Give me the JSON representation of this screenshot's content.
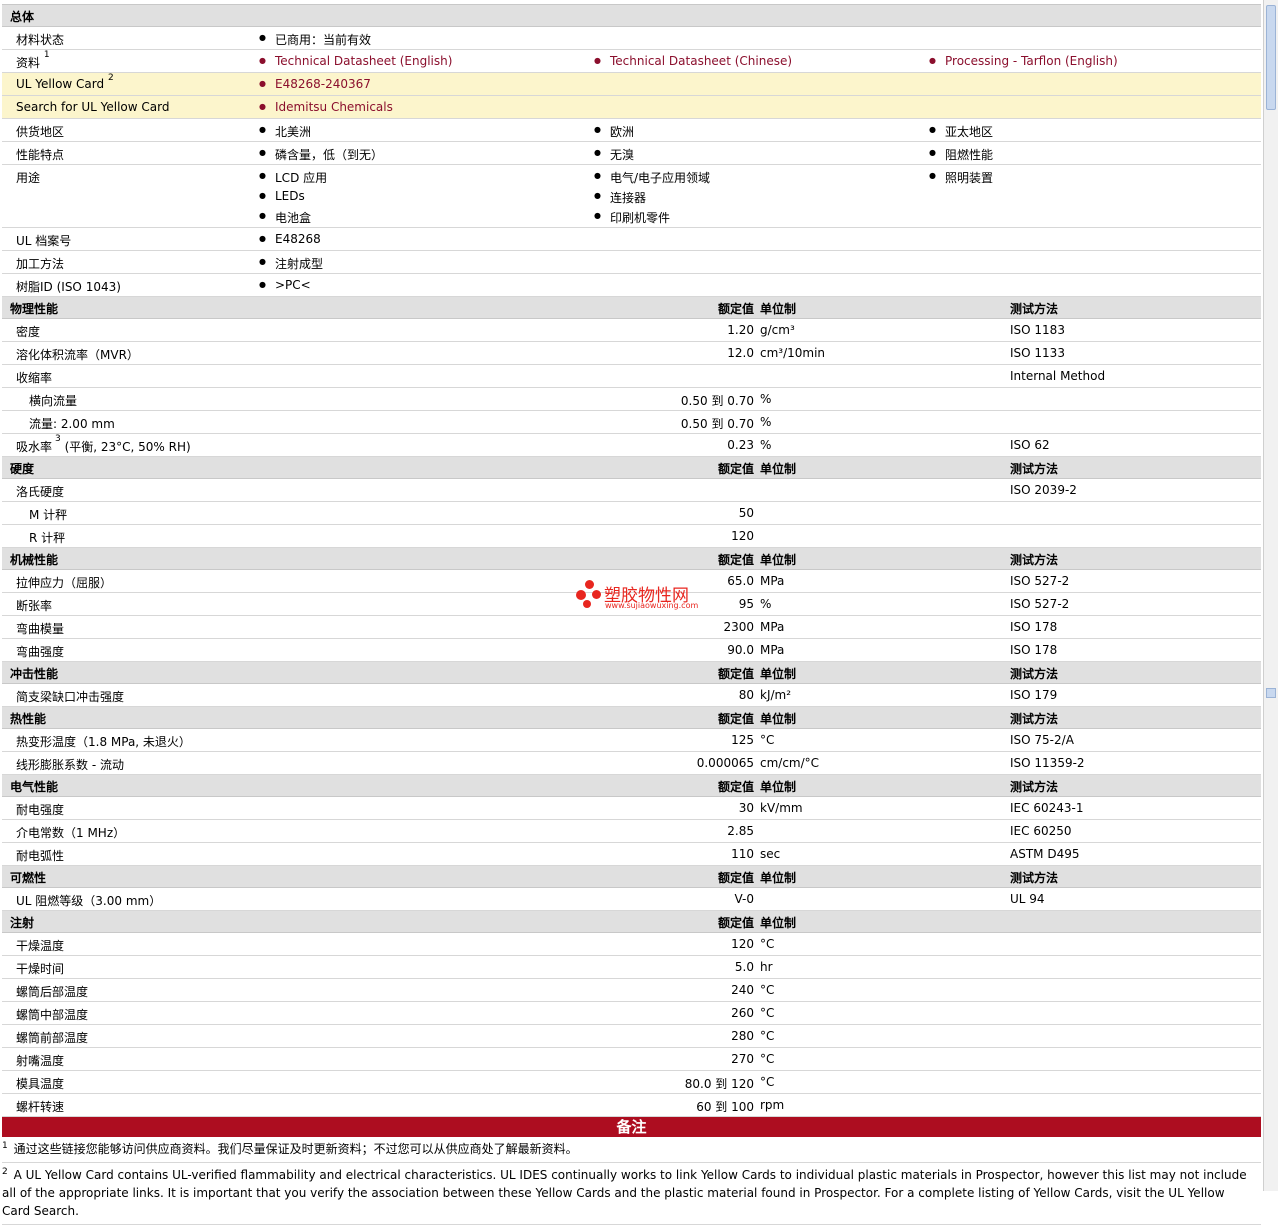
{
  "general": {
    "title": "总体",
    "material_status": {
      "label": "材料状态",
      "value": "已商用：当前有效"
    },
    "documents": {
      "label": "资料",
      "note": "1",
      "links": [
        "Technical Datasheet (English)",
        "Technical Datasheet (Chinese)",
        "Processing - Tarflon (English)"
      ]
    },
    "ul_yellow_card": {
      "label": "UL Yellow Card",
      "note": "2",
      "value": "E48268-240367"
    },
    "ul_search": {
      "label": "Search for UL Yellow Card",
      "value": "Idemitsu Chemicals"
    },
    "availability": {
      "label": "供货地区",
      "values": [
        "北美洲",
        "欧洲",
        "亚太地区"
      ]
    },
    "features": {
      "label": "性能特点",
      "values": [
        "磷含量，低（到无）",
        "无溴",
        "阻燃性能"
      ]
    },
    "uses": {
      "label": "用途",
      "values": [
        "LCD 应用",
        "电气/电子应用领域",
        "照明装置",
        "LEDs",
        "连接器",
        "电池盒",
        "印刷机零件"
      ]
    },
    "ul_file": {
      "label": "UL 档案号",
      "value": "E48268"
    },
    "processing": {
      "label": "加工方法",
      "value": "注射成型"
    },
    "resin_id": {
      "label": "树脂ID (ISO 1043)",
      "value": ">PC<"
    }
  },
  "headers": {
    "nominal": "额定值",
    "unit": "单位制",
    "method": "测试方法"
  },
  "sections": [
    {
      "title": "物理性能",
      "show_method": true,
      "rows": [
        {
          "label": "密度",
          "value": "1.20",
          "unit": "g/cm³",
          "method": "ISO 1183"
        },
        {
          "label": "溶化体积流率（MVR）",
          "value": "12.0",
          "unit": "cm³/10min",
          "method": "ISO 1133"
        },
        {
          "label": "收缩率",
          "value": "",
          "unit": "",
          "method": "Internal Method"
        },
        {
          "label": "横向流量",
          "sub": true,
          "value": "0.50 到  0.70",
          "unit": "%",
          "method": ""
        },
        {
          "label": "流量: 2.00 mm",
          "sub": true,
          "value": "0.50 到  0.70",
          "unit": "%",
          "method": ""
        },
        {
          "label": "吸水率",
          "note": "3",
          "label2": " (平衡, 23°C, 50% RH)",
          "value": "0.23",
          "unit": "%",
          "method": "ISO 62"
        }
      ]
    },
    {
      "title": "硬度",
      "show_method": true,
      "rows": [
        {
          "label": "洛氏硬度",
          "value": "",
          "unit": "",
          "method": "ISO 2039-2"
        },
        {
          "label": "M 计秤",
          "sub": true,
          "value": "50",
          "unit": "",
          "method": ""
        },
        {
          "label": "R 计秤",
          "sub": true,
          "value": "120",
          "unit": "",
          "method": ""
        }
      ]
    },
    {
      "title": "机械性能",
      "show_method": true,
      "rows": [
        {
          "label": "拉伸应力（屈服）",
          "value": "65.0",
          "unit": "MPa",
          "method": "ISO 527-2"
        },
        {
          "label": "断张率",
          "value": "95",
          "unit": "%",
          "method": "ISO 527-2"
        },
        {
          "label": "弯曲模量",
          "value": "2300",
          "unit": "MPa",
          "method": "ISO 178"
        },
        {
          "label": "弯曲强度",
          "value": "90.0",
          "unit": "MPa",
          "method": "ISO 178"
        }
      ]
    },
    {
      "title": "冲击性能",
      "show_method": true,
      "rows": [
        {
          "label": "简支梁缺口冲击强度",
          "value": "80",
          "unit": "kJ/m²",
          "method": "ISO 179"
        }
      ]
    },
    {
      "title": "热性能",
      "show_method": true,
      "rows": [
        {
          "label": "热变形温度（1.8 MPa, 未退火）",
          "value": "125",
          "unit": "°C",
          "method": "ISO 75-2/A"
        },
        {
          "label": "线形膨胀系数 - 流动",
          "value": "0.000065",
          "unit": "cm/cm/°C",
          "method": "ISO 11359-2"
        }
      ]
    },
    {
      "title": "电气性能",
      "show_method": true,
      "rows": [
        {
          "label": "耐电强度",
          "value": "30",
          "unit": "kV/mm",
          "method": "IEC 60243-1"
        },
        {
          "label": "介电常数（1 MHz）",
          "value": "2.85",
          "unit": "",
          "method": "IEC 60250"
        },
        {
          "label": "耐电弧性",
          "value": "110",
          "unit": "sec",
          "method": "ASTM D495"
        }
      ]
    },
    {
      "title": "可燃性",
      "show_method": true,
      "rows": [
        {
          "label": "UL 阻燃等级（3.00 mm）",
          "value": "V-0",
          "unit": "",
          "method": "UL 94"
        }
      ]
    },
    {
      "title": "注射",
      "show_method": false,
      "rows": [
        {
          "label": "干燥温度",
          "value": "120",
          "unit": "°C",
          "method": ""
        },
        {
          "label": "干燥时间",
          "value": "5.0",
          "unit": "hr",
          "method": ""
        },
        {
          "label": "螺筒后部温度",
          "value": "240",
          "unit": "°C",
          "method": ""
        },
        {
          "label": "螺筒中部温度",
          "value": "260",
          "unit": "°C",
          "method": ""
        },
        {
          "label": "螺筒前部温度",
          "value": "280",
          "unit": "°C",
          "method": ""
        },
        {
          "label": "射嘴温度",
          "value": "270",
          "unit": "°C",
          "method": ""
        },
        {
          "label": "模具温度",
          "value": "80.0 到  120",
          "unit": "°C",
          "method": ""
        },
        {
          "label": "螺杆转速",
          "value": "60 到  100",
          "unit": "rpm",
          "method": ""
        }
      ]
    }
  ],
  "notes": {
    "title": "备注",
    "items": [
      {
        "num": "1",
        "text": "通过这些链接您能够访问供应商资料。我们尽量保证及时更新资料；不过您可以从供应商处了解最新资料。"
      },
      {
        "num": "2",
        "text": "A UL Yellow Card contains UL-verified flammability and electrical characteristics. UL IDES continually works to link Yellow Cards to individual plastic materials in Prospector, however this list may not include all of the appropriate links. It is important that you verify the association between these Yellow Cards and the plastic material found in Prospector. For a complete listing of Yellow Cards, visit the UL Yellow Card Search."
      }
    ]
  },
  "watermark": {
    "text": "塑胶物性网",
    "url": "www.sujiaowuxing.com"
  }
}
